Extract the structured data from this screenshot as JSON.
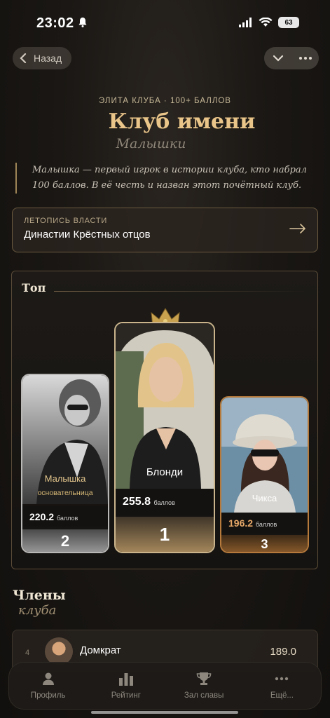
{
  "status": {
    "time": "23:02",
    "battery": "63"
  },
  "nav": {
    "back_label": "Назад"
  },
  "header": {
    "eyebrow": "ЭЛИТА КЛУБА · 100+ БАЛЛОВ",
    "title": "Клуб имени",
    "subtitle": "Малышки"
  },
  "quote": "Малышка — первый игрок в истории клуба, кто набрал 100 баллов. В её честь и назван этот почётный клуб.",
  "chronicle": {
    "eyebrow": "ЛЕТОПИСЬ ВЛАСТИ",
    "title": "Династии Крёстных отцов"
  },
  "top": {
    "title": "Топ",
    "podium": [
      {
        "rank": "2",
        "name": "Малышка",
        "role": "основательница",
        "score": "220.2",
        "unit": "баллов"
      },
      {
        "rank": "1",
        "name": "Блонди",
        "score": "255.8",
        "unit": "баллов"
      },
      {
        "rank": "3",
        "name": "Чикса",
        "score": "196.2",
        "unit": "баллов"
      }
    ]
  },
  "members": {
    "title": "Члены",
    "subtitle": "клуба",
    "items": [
      {
        "rank": "4",
        "name": "Домкрат",
        "score": "189.0"
      }
    ]
  },
  "tabbar": [
    {
      "label": "Профиль",
      "icon": "person-icon"
    },
    {
      "label": "Рейтинг",
      "icon": "bar-chart-icon"
    },
    {
      "label": "Зал славы",
      "icon": "trophy-icon"
    },
    {
      "label": "Ещё...",
      "icon": "more-dots-icon"
    }
  ],
  "colors": {
    "gold": "#e9c58a",
    "bronze": "#b57a3c",
    "silver": "#b9b8b6",
    "background": "#1a1714"
  }
}
